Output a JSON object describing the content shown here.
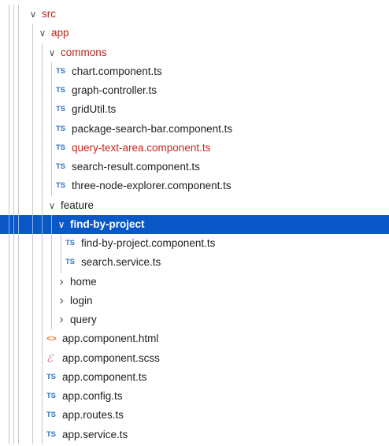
{
  "colors": {
    "selection_bg": "#0a58c8",
    "modified_text": "#b5261e",
    "ts_icon": "#2f74c0",
    "html_icon": "#e37933",
    "scss_icon": "#cd6799"
  },
  "tree": [
    {
      "label": "src",
      "kind": "folder",
      "expanded": true,
      "depth": 0,
      "modified": true
    },
    {
      "label": "app",
      "kind": "folder",
      "expanded": true,
      "depth": 1,
      "modified": true
    },
    {
      "label": "commons",
      "kind": "folder",
      "expanded": true,
      "depth": 2,
      "modified": true
    },
    {
      "label": "chart.component.ts",
      "kind": "file",
      "icon": "ts",
      "icon_text": "TS",
      "depth": 3
    },
    {
      "label": "graph-controller.ts",
      "kind": "file",
      "icon": "ts",
      "icon_text": "TS",
      "depth": 3
    },
    {
      "label": "gridUtil.ts",
      "kind": "file",
      "icon": "ts",
      "icon_text": "TS",
      "depth": 3
    },
    {
      "label": "package-search-bar.component.ts",
      "kind": "file",
      "icon": "ts",
      "icon_text": "TS",
      "depth": 3
    },
    {
      "label": "query-text-area.component.ts",
      "kind": "file",
      "icon": "ts",
      "icon_text": "TS",
      "depth": 3,
      "modified": true
    },
    {
      "label": "search-result.component.ts",
      "kind": "file",
      "icon": "ts",
      "icon_text": "TS",
      "depth": 3
    },
    {
      "label": "three-node-explorer.component.ts",
      "kind": "file",
      "icon": "ts",
      "icon_text": "TS",
      "depth": 3
    },
    {
      "label": "feature",
      "kind": "folder",
      "expanded": true,
      "depth": 2
    },
    {
      "label": "find-by-project",
      "kind": "folder",
      "expanded": true,
      "depth": 3,
      "selected": true
    },
    {
      "label": "find-by-project.component.ts",
      "kind": "file",
      "icon": "ts",
      "icon_text": "TS",
      "depth": 4
    },
    {
      "label": "search.service.ts",
      "kind": "file",
      "icon": "ts",
      "icon_text": "TS",
      "depth": 4
    },
    {
      "label": "home",
      "kind": "folder",
      "expanded": false,
      "depth": 3
    },
    {
      "label": "login",
      "kind": "folder",
      "expanded": false,
      "depth": 3
    },
    {
      "label": "query",
      "kind": "folder",
      "expanded": false,
      "depth": 3
    },
    {
      "label": "app.component.html",
      "kind": "file",
      "icon": "html",
      "icon_text": "<>",
      "depth": 2
    },
    {
      "label": "app.component.scss",
      "kind": "file",
      "icon": "scss",
      "icon_text": "ℰ",
      "depth": 2
    },
    {
      "label": "app.component.ts",
      "kind": "file",
      "icon": "ts",
      "icon_text": "TS",
      "depth": 2
    },
    {
      "label": "app.config.ts",
      "kind": "file",
      "icon": "ts",
      "icon_text": "TS",
      "depth": 2
    },
    {
      "label": "app.routes.ts",
      "kind": "file",
      "icon": "ts",
      "icon_text": "TS",
      "depth": 2
    },
    {
      "label": "app.service.ts",
      "kind": "file",
      "icon": "ts",
      "icon_text": "TS",
      "depth": 2
    }
  ]
}
